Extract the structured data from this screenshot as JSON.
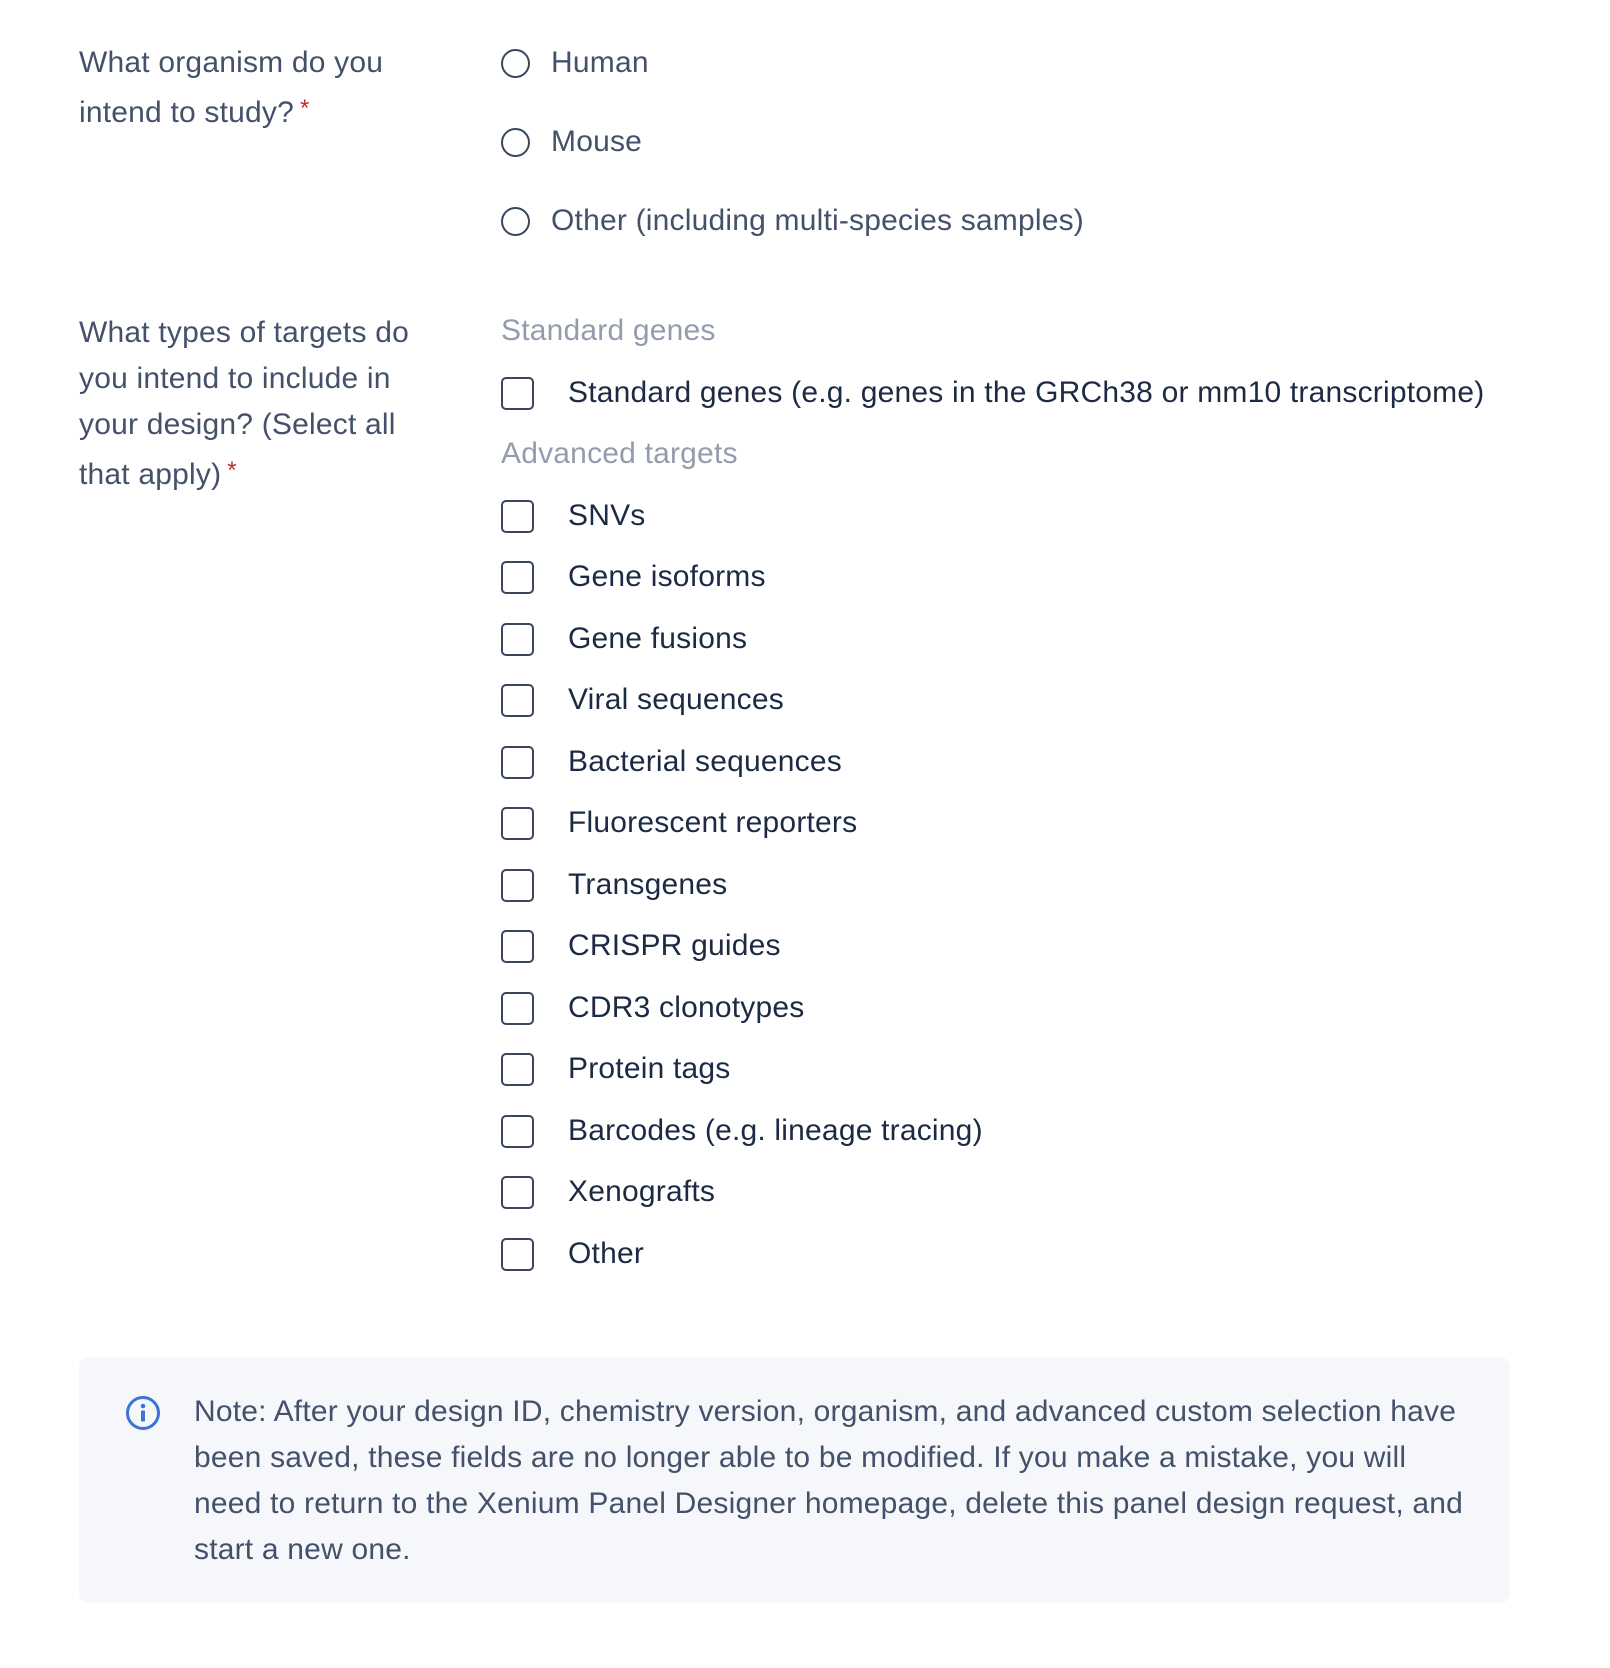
{
  "organism_question": {
    "label_line1": "What organism do you",
    "label_line2": "intend to study?",
    "required_mark": "*",
    "options": [
      {
        "label": "Human",
        "selected": false
      },
      {
        "label": "Mouse",
        "selected": false
      },
      {
        "label": "Other (including multi-species samples)",
        "selected": false
      }
    ]
  },
  "targets_question": {
    "label_line1": "What types of targets do",
    "label_line2": "you intend to include in",
    "label_line3": "your design? (Select all",
    "label_line4": "that apply)",
    "required_mark": "*",
    "standard_header": "Standard genes",
    "standard_options": [
      {
        "label": "Standard genes (e.g. genes in the GRCh38 or mm10 transcriptome)",
        "checked": false
      }
    ],
    "advanced_header": "Advanced targets",
    "advanced_options": [
      {
        "label": "SNVs",
        "checked": false
      },
      {
        "label": "Gene isoforms",
        "checked": false
      },
      {
        "label": "Gene fusions",
        "checked": false
      },
      {
        "label": "Viral sequences",
        "checked": false
      },
      {
        "label": "Bacterial sequences",
        "checked": false
      },
      {
        "label": "Fluorescent reporters",
        "checked": false
      },
      {
        "label": "Transgenes",
        "checked": false
      },
      {
        "label": "CRISPR guides",
        "checked": false
      },
      {
        "label": "CDR3 clonotypes",
        "checked": false
      },
      {
        "label": "Protein tags",
        "checked": false
      },
      {
        "label": "Barcodes (e.g. lineage tracing)",
        "checked": false
      },
      {
        "label": "Xenografts",
        "checked": false
      },
      {
        "label": "Other",
        "checked": false
      }
    ]
  },
  "note": {
    "icon": "info-icon",
    "text": "Note: After your design ID, chemistry version, organism, and advanced custom selection have been saved, these fields are no longer able to be modified. If you make a mistake, you will need to return to the Xenium Panel Designer homepage, delete this panel design request, and start a new one."
  },
  "colors": {
    "required": "#c22c2c",
    "info_icon": "#3b73d6",
    "note_bg": "#f5f7fb"
  }
}
